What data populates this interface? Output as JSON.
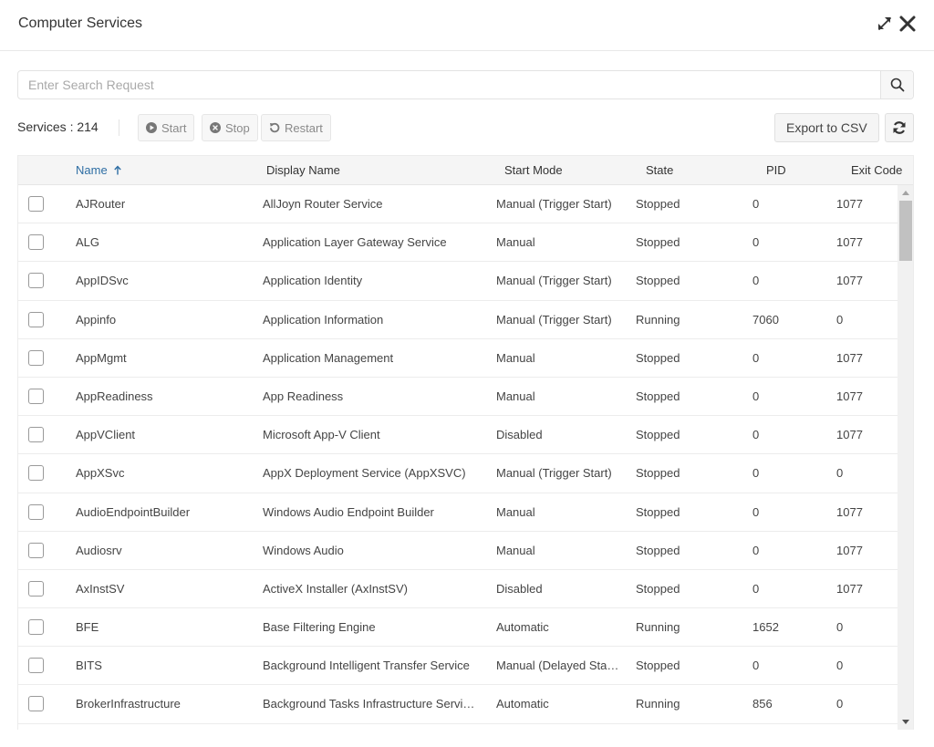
{
  "window": {
    "title": "Computer Services"
  },
  "search": {
    "placeholder": "Enter Search Request",
    "value": ""
  },
  "toolbar": {
    "count_label": "Services : 214",
    "start_label": "Start",
    "stop_label": "Stop",
    "restart_label": "Restart",
    "export_label": "Export to CSV"
  },
  "table": {
    "columns": {
      "name": "Name",
      "display_name": "Display Name",
      "start_mode": "Start Mode",
      "state": "State",
      "pid": "PID",
      "exit_code": "Exit Code"
    },
    "sort": {
      "column": "name",
      "direction": "ascending"
    },
    "rows": [
      {
        "name": "AJRouter",
        "display_name": "AllJoyn Router Service",
        "start_mode": "Manual (Trigger Start)",
        "state": "Stopped",
        "pid": "0",
        "exit_code": "1077"
      },
      {
        "name": "ALG",
        "display_name": "Application Layer Gateway Service",
        "start_mode": "Manual",
        "state": "Stopped",
        "pid": "0",
        "exit_code": "1077"
      },
      {
        "name": "AppIDSvc",
        "display_name": "Application Identity",
        "start_mode": "Manual (Trigger Start)",
        "state": "Stopped",
        "pid": "0",
        "exit_code": "1077"
      },
      {
        "name": "Appinfo",
        "display_name": "Application Information",
        "start_mode": "Manual (Trigger Start)",
        "state": "Running",
        "pid": "7060",
        "exit_code": "0"
      },
      {
        "name": "AppMgmt",
        "display_name": "Application Management",
        "start_mode": "Manual",
        "state": "Stopped",
        "pid": "0",
        "exit_code": "1077"
      },
      {
        "name": "AppReadiness",
        "display_name": "App Readiness",
        "start_mode": "Manual",
        "state": "Stopped",
        "pid": "0",
        "exit_code": "1077"
      },
      {
        "name": "AppVClient",
        "display_name": "Microsoft App-V Client",
        "start_mode": "Disabled",
        "state": "Stopped",
        "pid": "0",
        "exit_code": "1077"
      },
      {
        "name": "AppXSvc",
        "display_name": "AppX Deployment Service (AppXSVC)",
        "start_mode": "Manual (Trigger Start)",
        "state": "Stopped",
        "pid": "0",
        "exit_code": "0"
      },
      {
        "name": "AudioEndpointBuilder",
        "display_name": "Windows Audio Endpoint Builder",
        "start_mode": "Manual",
        "state": "Stopped",
        "pid": "0",
        "exit_code": "1077"
      },
      {
        "name": "Audiosrv",
        "display_name": "Windows Audio",
        "start_mode": "Manual",
        "state": "Stopped",
        "pid": "0",
        "exit_code": "1077"
      },
      {
        "name": "AxInstSV",
        "display_name": "ActiveX Installer (AxInstSV)",
        "start_mode": "Disabled",
        "state": "Stopped",
        "pid": "0",
        "exit_code": "1077"
      },
      {
        "name": "BFE",
        "display_name": "Base Filtering Engine",
        "start_mode": "Automatic",
        "state": "Running",
        "pid": "1652",
        "exit_code": "0"
      },
      {
        "name": "BITS",
        "display_name": "Background Intelligent Transfer Service",
        "start_mode": "Manual (Delayed Sta…",
        "state": "Stopped",
        "pid": "0",
        "exit_code": "0"
      },
      {
        "name": "BrokerInfrastructure",
        "display_name": "Background Tasks Infrastructure Servi…",
        "start_mode": "Automatic",
        "state": "Running",
        "pid": "856",
        "exit_code": "0"
      }
    ]
  },
  "icons": {
    "expand": "expand-arrows-icon",
    "close": "close-x-icon",
    "search": "magnifier-icon",
    "start": "play-circle-icon",
    "stop": "x-circle-icon",
    "restart": "rotate-ccw-icon",
    "refresh": "sync-icon",
    "sort": "arrow-up-icon"
  },
  "colors": {
    "accent": "#2d6da3",
    "header_bg": "#f5f5f5",
    "disabled_text": "#8a8a8a"
  }
}
